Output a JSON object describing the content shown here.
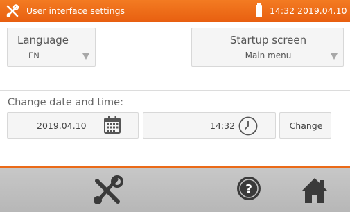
{
  "header": {
    "title": "User interface settings",
    "clock": "14:32 2019.04.10",
    "accent_color": "#ee6d1a",
    "icons": [
      "tools-icon",
      "battery-icon"
    ]
  },
  "language": {
    "label": "Language",
    "value": "EN"
  },
  "startup": {
    "label": "Startup screen",
    "value": "Main menu"
  },
  "datetime": {
    "section_label": "Change date and time:",
    "date": "2019.04.10",
    "time": "14:32",
    "change_label": "Change",
    "icons": [
      "calendar-icon",
      "clock-icon"
    ]
  },
  "bottom_bar": {
    "icons": [
      "tools-icon",
      "help-icon",
      "home-icon"
    ]
  }
}
